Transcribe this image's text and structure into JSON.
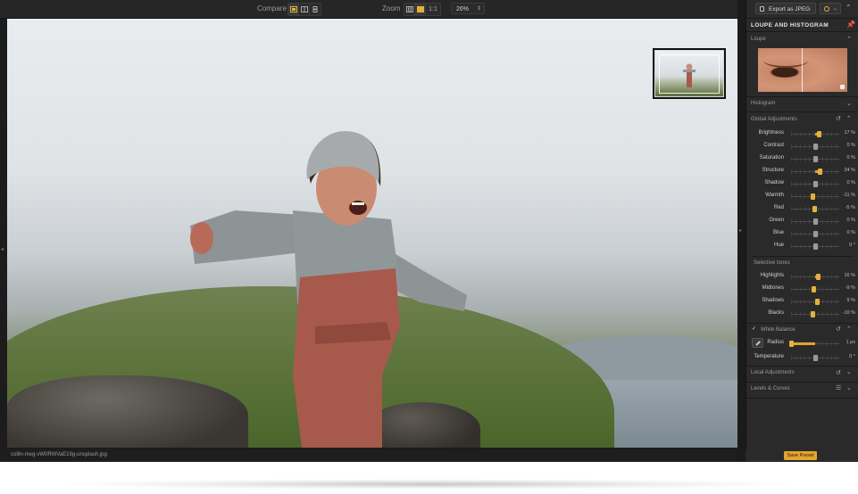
{
  "toolbar": {
    "compare_label": "Compare",
    "zoom_label": "Zoom",
    "one_to_one": "1:1",
    "zoom_value": "26%"
  },
  "image": {
    "filename": "collin-meg-vW0RWVaE19g-unsplash.jpg"
  },
  "panel": {
    "export_label": "Export as JPEG",
    "title": "LOUPE AND HISTOGRAM",
    "loupe_label": "Loupe",
    "histogram_label": "Histogram",
    "global_label": "Global Adjustments",
    "selective_label": "Selective tones",
    "white_balance_label": "White Balance",
    "local_label": "Local Adjustments",
    "levels_label": "Levels & Curves",
    "save_preset": "Save Preset"
  },
  "global": [
    {
      "label": "Brightness",
      "value": "17 %",
      "pos": 0.57
    },
    {
      "label": "Contrast",
      "value": "0 %",
      "pos": 0.5
    },
    {
      "label": "Saturation",
      "value": "0 %",
      "pos": 0.5
    },
    {
      "label": "Structure",
      "value": "24 %",
      "pos": 0.6
    },
    {
      "label": "Shadow",
      "value": "0 %",
      "pos": 0.5
    },
    {
      "label": "Warmth",
      "value": "-11 %",
      "pos": 0.45
    },
    {
      "label": "Red",
      "value": "-5 %",
      "pos": 0.48
    },
    {
      "label": "Green",
      "value": "0 %",
      "pos": 0.5
    },
    {
      "label": "Blue",
      "value": "0 %",
      "pos": 0.5
    },
    {
      "label": "Hue",
      "value": "0 °",
      "pos": 0.5
    }
  ],
  "selective": [
    {
      "label": "Highlights",
      "value": "16 %",
      "pos": 0.56
    },
    {
      "label": "Midtones",
      "value": "-9 %",
      "pos": 0.46
    },
    {
      "label": "Shadows",
      "value": "9 %",
      "pos": 0.54
    },
    {
      "label": "Blacks",
      "value": "-10 %",
      "pos": 0.45
    }
  ],
  "white_balance": [
    {
      "label": "Radius",
      "value": "1 px",
      "pos": 0.0
    },
    {
      "label": "Temperature",
      "value": "0 °",
      "pos": 0.5
    }
  ],
  "colors": {
    "accent": "#e3a52c"
  }
}
